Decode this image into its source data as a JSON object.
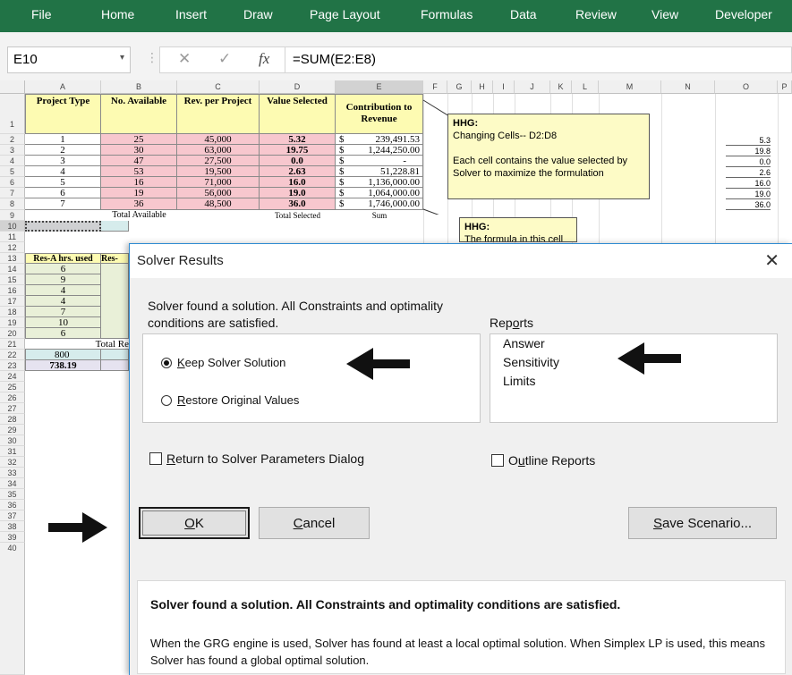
{
  "ribbon": {
    "tabs": [
      "File",
      "Home",
      "Insert",
      "Draw",
      "Page Layout",
      "Formulas",
      "Data",
      "Review",
      "View",
      "Developer"
    ],
    "color": "#217346"
  },
  "formula_bar": {
    "name_box": "E10",
    "cancel_icon": "✕",
    "enter_icon": "✓",
    "fx_icon": "fx",
    "formula": "=SUM(E2:E8)"
  },
  "sheet": {
    "columns": [
      "A",
      "B",
      "C",
      "D",
      "E",
      "F",
      "G",
      "H",
      "I",
      "J",
      "K",
      "L",
      "M",
      "N",
      "O",
      "P"
    ],
    "rows": [
      "1",
      "2",
      "3",
      "4",
      "5",
      "6",
      "7",
      "8",
      "9",
      "10",
      "11",
      "12",
      "13",
      "14",
      "15",
      "16",
      "17",
      "18",
      "19",
      "20",
      "21",
      "22",
      "23",
      "24",
      "25",
      "26",
      "27",
      "28",
      "29",
      "30",
      "31",
      "32",
      "33",
      "34",
      "35",
      "36",
      "37",
      "38",
      "39",
      "40"
    ],
    "headers": [
      "Project Type",
      "No. Available",
      "Rev. per Project",
      "Value Selected",
      "Contribution to Revenue"
    ],
    "data_rows": [
      [
        "1",
        "25",
        "45,000",
        "5.32",
        "$",
        "239,491.53"
      ],
      [
        "2",
        "30",
        "63,000",
        "19.75",
        "$",
        "1,244,250.00"
      ],
      [
        "3",
        "47",
        "27,500",
        "0.0",
        "$",
        "-"
      ],
      [
        "4",
        "53",
        "19,500",
        "2.63",
        "$",
        "51,228.81"
      ],
      [
        "5",
        "16",
        "71,000",
        "16.0",
        "$",
        "1,136,000.00"
      ],
      [
        "6",
        "19",
        "56,000",
        "19.0",
        "$",
        "1,064,000.00"
      ],
      [
        "7",
        "36",
        "48,500",
        "36.0",
        "$",
        "1,746,000.00"
      ]
    ],
    "row9": {
      "b": "Total Available",
      "d": "Total Selected",
      "e": "Sum"
    },
    "res_headers": [
      "Res-A hrs. used",
      "Res-"
    ],
    "res_values": [
      "6",
      "9",
      "4",
      "4",
      "7",
      "10",
      "6"
    ],
    "row21": "Total Re",
    "row22": "800",
    "row23": "738.19",
    "right_values": [
      "5.3",
      "19.8",
      "0.0",
      "2.6",
      "16.0",
      "19.0",
      "36.0"
    ],
    "comment1": {
      "title": "HHG:",
      "line1": "Changing Cells--     D2:D8",
      "line2": "Each cell contains the value selected by Solver to maximize the formulation"
    },
    "comment2": {
      "title": "HHG:",
      "line1": "The formula in this cell"
    }
  },
  "dialog": {
    "title": "Solver Results",
    "close_icon": "✕",
    "message": "Solver found a solution.  All Constraints and optimality conditions are satisfied.",
    "keep_label_u": "K",
    "keep_label_rest": "eep Solver Solution",
    "restore_label_u": "R",
    "restore_label_rest": "estore Original Values",
    "reports_label_pre": "Rep",
    "reports_label_u": "o",
    "reports_label_post": "rts",
    "reports": [
      "Answer",
      "Sensitivity",
      "Limits"
    ],
    "return_label_u": "R",
    "return_label_rest": "eturn to Solver Parameters Dialog",
    "outline_label_pre": "O",
    "outline_label_u": "u",
    "outline_label_post": "tline Reports",
    "ok_label": "OK",
    "ok_u": "O",
    "ok_rest": "K",
    "cancel_u": "C",
    "cancel_rest": "ancel",
    "save_u": "S",
    "save_rest": "ave Scenario...",
    "detail_heading": "Solver found a solution.  All Constraints and optimality conditions are satisfied.",
    "detail_text": "When the GRG engine is used, Solver has found at least a local optimal solution. When Simplex LP is used, this means Solver has found a global optimal solution."
  }
}
